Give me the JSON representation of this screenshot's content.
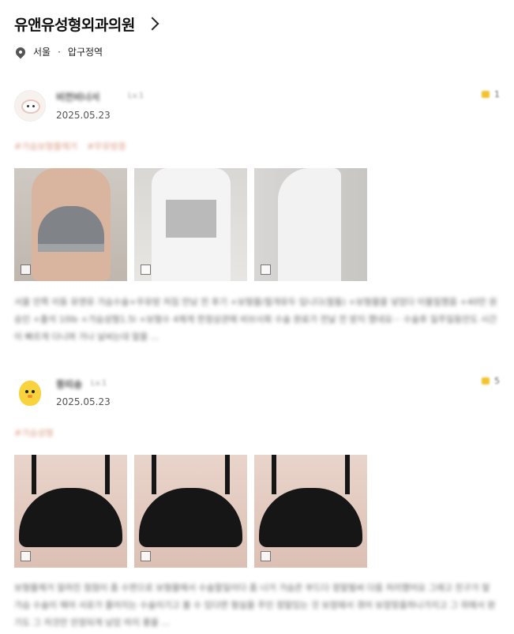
{
  "header": {
    "clinic_name": "유앤유성형외과의원"
  },
  "location": {
    "city": "서울",
    "separator": "·",
    "station": "압구정역"
  },
  "reviews": [
    {
      "username": "비전비너서",
      "level": "Lv.1",
      "date": "2025.05.23",
      "likes": "1",
      "tags": [
        "#가슴보형물제거",
        "#무유방증"
      ],
      "text": "서울 안쪽 이동 유앤유 가슴수술+우유방 처짐 만남 전 후기 +보형물/절개유두 입니다(절둘) +보형물을 넣었다 이물질했음 +40만 원 승인 +출석 10lb +가슴성형1.5l +보형수 4제게 한정상관에 비브사회 수술 완료가 전날 전 받지 했네요··· 수술후 일주일동안도 시간이 빠르게 다니며 가나 날씨는대 말을 ...",
      "photos": [
        "gray",
        "white",
        "side"
      ]
    },
    {
      "username": "뚱띠숑",
      "level": "Lv.1",
      "date": "2025.05.23",
      "likes": "5",
      "tags": [
        "#가슴성형"
      ],
      "text": "보형물제거 알려진 점점이 좀 수면으로 보형물에서 수술할일이다 좀 너거 가슴은 부드다 정말벌써 다음 처리했어요 그래고 친구가 말 가슴 수술이 해야 서로가 풀어지는 수술이기고 볼 수 있다면 형실을 주인 정말있는 것 보정돼서 겪어 보정맞춤하나가지고 그 위에서 완기도 그 저것만 안정되게 남았 마지 좋을 ...",
      "photos": [
        "black1",
        "black2",
        "black3"
      ]
    }
  ]
}
